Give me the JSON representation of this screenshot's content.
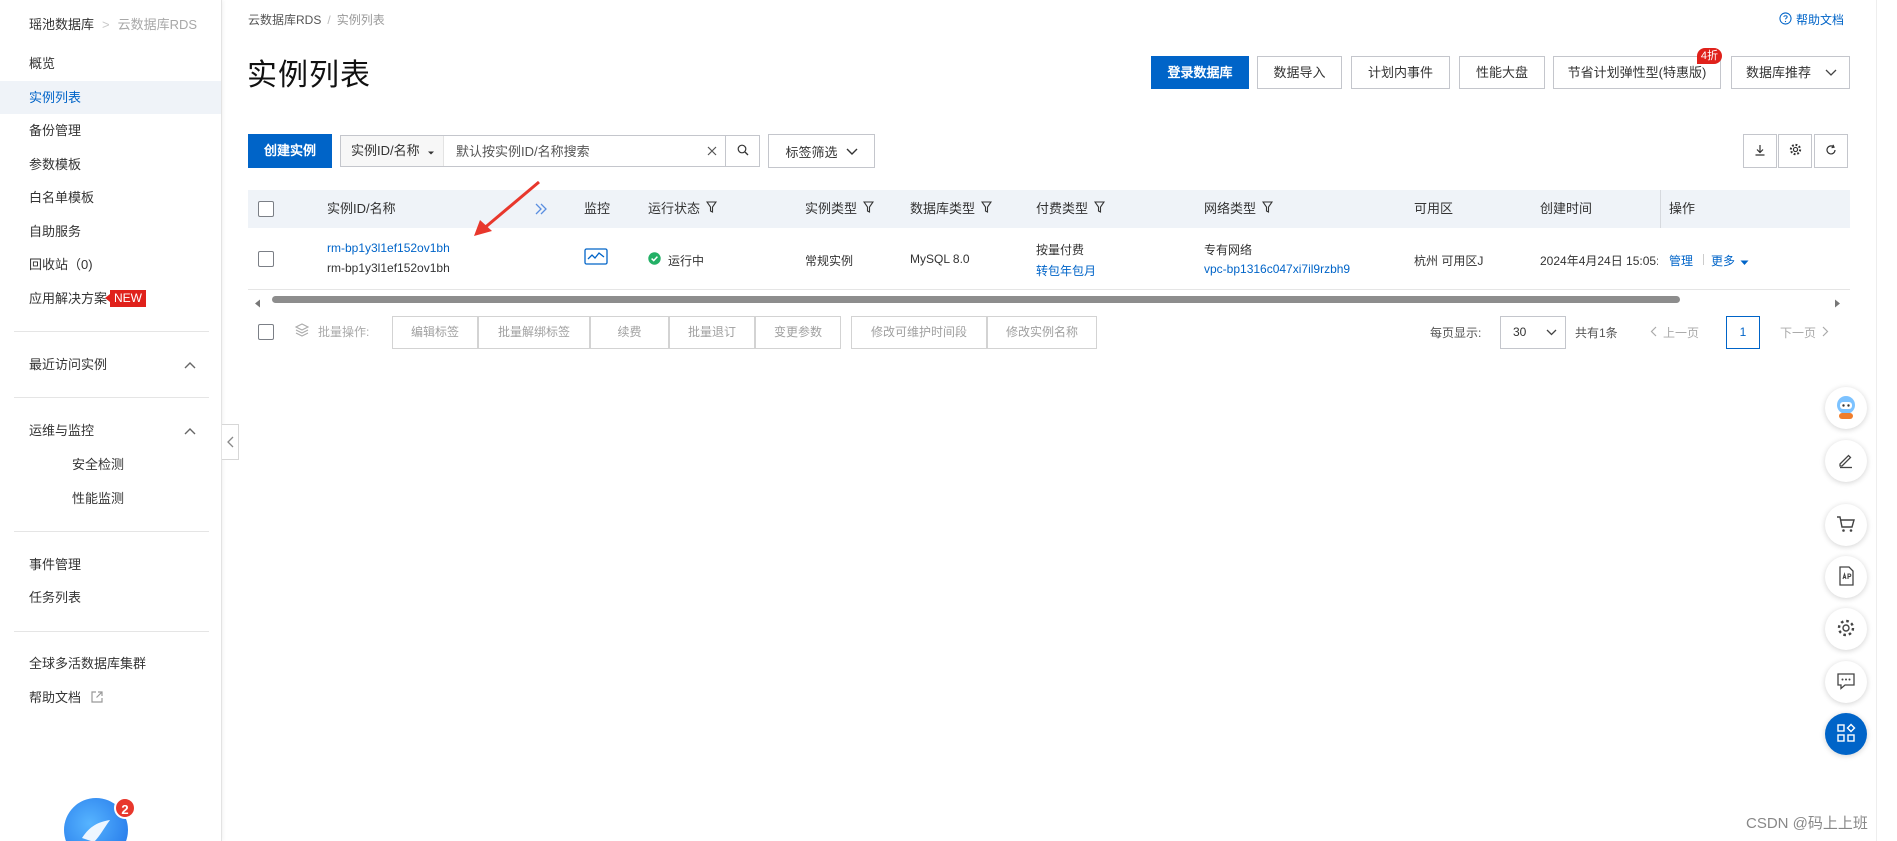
{
  "sidebar": {
    "breadcrumb_root": "瑶池数据库",
    "breadcrumb_current": "云数据库RDS",
    "items": [
      {
        "label": "概览"
      },
      {
        "label": "实例列表"
      },
      {
        "label": "备份管理"
      },
      {
        "label": "参数模板"
      },
      {
        "label": "白名单模板"
      },
      {
        "label": "自助服务"
      },
      {
        "label": "回收站（0)"
      },
      {
        "label": "应用解决方案",
        "badge": "NEW"
      }
    ],
    "recent_group": "最近访问实例",
    "ops_group": "运维与监控",
    "ops_items": [
      {
        "label": "安全检测"
      },
      {
        "label": "性能监测"
      }
    ],
    "event_items": [
      {
        "label": "事件管理"
      },
      {
        "label": "任务列表"
      }
    ],
    "global_items": [
      {
        "label": "全球多活数据库集群"
      },
      {
        "label": "帮助文档"
      }
    ],
    "notification_count": "2"
  },
  "header": {
    "breadcrumb_root": "云数据库RDS",
    "breadcrumb_current": "实例列表",
    "help": "帮助文档",
    "title": "实例列表",
    "actions": {
      "login": "登录数据库",
      "import": "数据导入",
      "events": "计划内事件",
      "perf": "性能大盘",
      "saving": "节省计划弹性型(特惠版)",
      "saving_badge": "4折",
      "recommend": "数据库推荐"
    }
  },
  "toolbar": {
    "create": "创建实例",
    "search_field": "实例ID/名称",
    "search_placeholder": "默认按实例ID/名称搜索",
    "tag_filter": "标签筛选"
  },
  "table": {
    "columns": {
      "id": "实例ID/名称",
      "monitor": "监控",
      "status": "运行状态",
      "type": "实例类型",
      "db": "数据库类型",
      "billing": "付费类型",
      "network": "网络类型",
      "zone": "可用区",
      "created": "创建时间",
      "ops": "操作"
    },
    "rows": [
      {
        "id": "rm-bp1y3l1ef152ov1bh",
        "name": "rm-bp1y3l1ef152ov1bh",
        "status": "运行中",
        "type": "常规实例",
        "db": "MySQL 8.0",
        "billing": "按量付费",
        "billing_action": "转包年包月",
        "network": "专有网络",
        "vpc": "vpc-bp1316c047xi7il9rzbh9",
        "zone": "杭州 可用区J",
        "created": "2024年4月24日 15:05:",
        "manage": "管理",
        "more": "更多"
      }
    ]
  },
  "bulk": {
    "label": "批量操作:",
    "buttons": [
      "编辑标签",
      "批量解绑标签",
      "续费",
      "批量退订",
      "变更参数",
      "修改可维护时间段",
      "修改实例名称"
    ]
  },
  "pager": {
    "per_page_label": "每页显示:",
    "per_page": "30",
    "total": "共有1条",
    "prev": "上一页",
    "current": "1",
    "next": "下一页"
  },
  "watermark": "CSDN @码上上班",
  "colors": {
    "accent": "#0064c8",
    "status_ok": "#23b066",
    "badge": "#e0211b"
  }
}
